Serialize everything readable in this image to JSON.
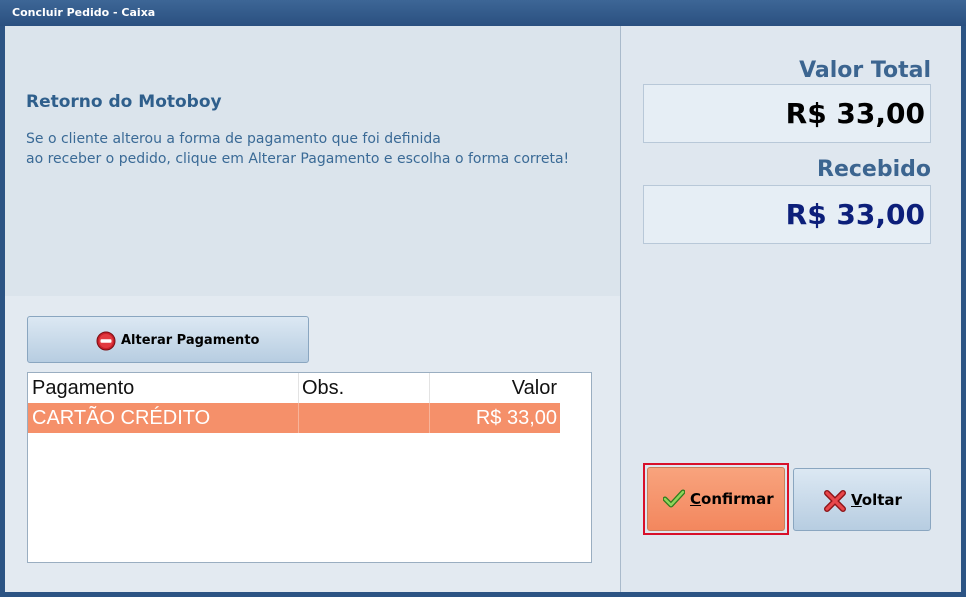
{
  "window": {
    "title": "Concluir Pedido - Caixa"
  },
  "info": {
    "heading": "Retorno do Motoboy",
    "lines": [
      "Se o cliente alterou a forma de pagamento que foi definida",
      "ao receber o pedido, clique em Alterar Pagamento e escolha o forma correta!"
    ]
  },
  "alter_button": {
    "label": "Alterar Pagamento",
    "icon": "stop-icon"
  },
  "grid": {
    "columns": [
      "Pagamento",
      "Obs.",
      "Valor"
    ],
    "rows": [
      {
        "pagamento": "CARTÃO CRÉDITO",
        "obs": "",
        "valor": "R$ 33,00"
      }
    ]
  },
  "summary": {
    "total_label": "Valor Total",
    "total_value": "R$ 33,00",
    "received_label": "Recebido",
    "received_value": "R$ 33,00"
  },
  "buttons": {
    "confirm_first": "C",
    "confirm_rest": "onfirmar",
    "back_first": "V",
    "back_rest": "oltar"
  },
  "colors": {
    "selected_row": "#f5906a",
    "confirm_button": "#f3875e",
    "focus_border": "#d8102a",
    "received_value": "#0c1f7a"
  }
}
